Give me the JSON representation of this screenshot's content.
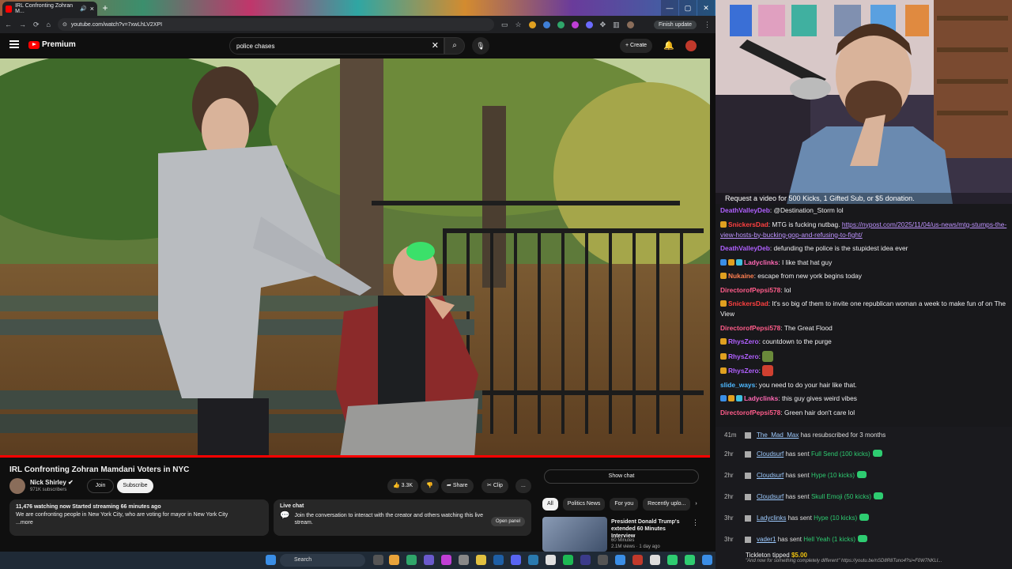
{
  "browser": {
    "tab_title": "IRL Confronting Zohran M...",
    "url": "youtube.com/watch?v=7xwLhLV2XPI",
    "finish_update": "Finish update"
  },
  "youtube": {
    "brand": "Premium",
    "search_value": "police chases",
    "create_label": "Create",
    "video_title": "IRL Confronting Zohran Mamdani Voters in NYC",
    "channel_name": "Nick Shirley",
    "subscribers": "971K subscribers",
    "join_label": "Join",
    "subscribe_label": "Subscribe",
    "likes": "3.3K",
    "share_label": "Share",
    "clip_label": "Clip",
    "more_label": "...",
    "desc_stats": "11,476 watching now  Started streaming 66 minutes ago",
    "desc_text": "We are confronting people in New York City, who are voting for mayor in New York City",
    "desc_more": "...more",
    "live_chat_title": "Live chat",
    "live_chat_text": "Join the conversation to interact with the creator and others watching this live stream.",
    "open_panel": "Open panel",
    "show_chat": "Show chat",
    "chips": [
      "All",
      "Politics News",
      "For you",
      "Recently uplo..."
    ],
    "rec_title": "President Donald Trump's extended 60 Minutes Interview",
    "rec_channel": "60 Minutes",
    "rec_meta": "2.1M views · 1 day ago"
  },
  "taskbar": {
    "search": "Search"
  },
  "stream": {
    "overlay_text": "Request a video for 500 Kicks, 1 Gifted Sub, or $5 donation.",
    "chat": [
      {
        "user": "DeathValleyDeb",
        "color": "#b060ff",
        "text": "@Destination_Storm lol"
      },
      {
        "user": "SnickersDad",
        "color": "#ff4040",
        "text": "MTG is fucking nutbag.",
        "link": "https://nypost.com/2025/11/04/us-news/mtg-stumps-the-view-hosts-by-bucking-gop-and-refusing-to-fight/"
      },
      {
        "user": "DeathValleyDeb",
        "color": "#b060ff",
        "text": "defunding the police is the stupidest idea ever"
      },
      {
        "user": "Ladyclinks",
        "color": "#ff69b4",
        "text": "I like that hat guy"
      },
      {
        "user": "Nukaine",
        "color": "#ff7f50",
        "text": "escape from new york begins today"
      },
      {
        "user": "DirectorofPepsi578",
        "color": "#ff5c8a",
        "text": "lol"
      },
      {
        "user": "SnickersDad",
        "color": "#ff4040",
        "text": "It's so big of them to invite one republican woman a week to make fun of on The View"
      },
      {
        "user": "DirectorofPepsi578",
        "color": "#ff5c8a",
        "text": "The Great Flood"
      },
      {
        "user": "RhysZero",
        "color": "#b060ff",
        "text": "countdown to the purge"
      },
      {
        "user": "RhysZero",
        "color": "#b060ff",
        "text": ""
      },
      {
        "user": "RhysZero",
        "color": "#b060ff",
        "text": ""
      },
      {
        "user": "slide_ways",
        "color": "#4db8ff",
        "text": "you need to do your hair like that."
      },
      {
        "user": "Ladyclinks",
        "color": "#ff69b4",
        "text": "this guy gives weird vibes"
      },
      {
        "user": "DirectorofPepsi578",
        "color": "#ff5c8a",
        "text": "Green hair don't care lol"
      }
    ],
    "events": [
      {
        "time": "41m",
        "name": "The_Mad_Max",
        "action": "has resubscribed for 3 months",
        "gift": ""
      },
      {
        "time": "2hr",
        "name": "Cloudsurf",
        "action": "has sent",
        "gift": "Full Send (100 kicks)"
      },
      {
        "time": "2hr",
        "name": "Cloudsurf",
        "action": "has sent",
        "gift": "Hype (10 kicks)"
      },
      {
        "time": "2hr",
        "name": "Cloudsurf",
        "action": "has sent",
        "gift": "Skull Emoji (50 kicks)"
      },
      {
        "time": "3hr",
        "name": "Ladyclinks",
        "action": "has sent",
        "gift": "Hype (10 kicks)"
      },
      {
        "time": "3hr",
        "name": "vader1",
        "action": "has sent",
        "gift": "Hell Yeah (1 kicks)"
      }
    ],
    "tip_user": "Tickleton",
    "tip_action": "tipped",
    "tip_amount": "$5.00",
    "tip_message": "\"And now for something completely different\" https://youtu.be/nSD8R8Tuno4?si=F0W7NKLI..."
  },
  "colors": {
    "accent": "#ff0000",
    "chat_bg": "#18181b",
    "yt_bg": "#0f0f0f",
    "kick_green": "#2ecc71"
  }
}
